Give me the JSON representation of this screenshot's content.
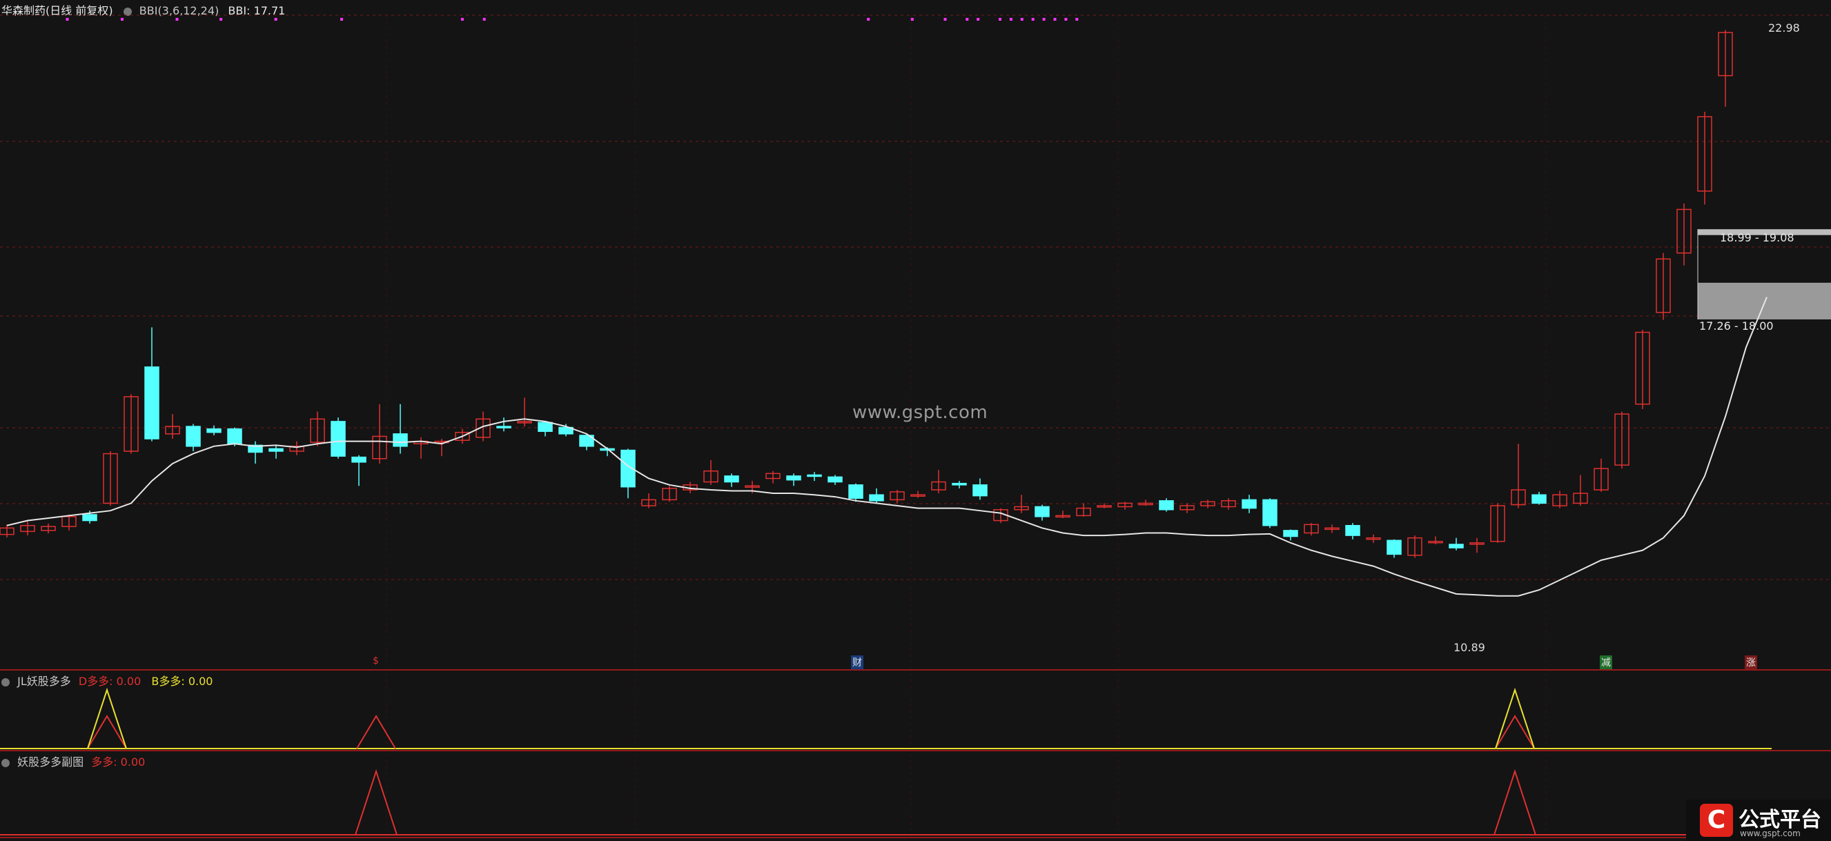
{
  "header": {
    "stock_name": "华森制药(日线 前复权)",
    "indicator_name": "BBI(3,6,12,24)",
    "indicator_value": "BBI: 17.71"
  },
  "sub1": {
    "name": "JL妖股多多",
    "d_label": "D多多: 0.00",
    "b_label": "B多多: 0.00"
  },
  "sub2": {
    "name": "妖股多多副图",
    "label": "多多: 0.00"
  },
  "markers": {
    "s": "$",
    "cai": "财",
    "jian": "减",
    "zhang": "涨"
  },
  "watermark": "www.gspt.com",
  "logo": {
    "text": "公式平台",
    "url": "www.gspt.com"
  },
  "colors": {
    "up": "#e03030",
    "down": "#54ffff",
    "bbi": "#e6e6e6",
    "d_line": "#e03030",
    "b_line": "#e8e030",
    "grid": "#7a1818",
    "dots": "#ff33ff"
  },
  "chart_data": {
    "type": "candlestick",
    "y_range": [
      10.2,
      23.4
    ],
    "annotations": {
      "high": "22.98",
      "low": "10.89",
      "zone_upper": "18.99 - 19.08",
      "zone_lower": "17.26 - 18.00"
    },
    "bbi": [
      13.1,
      13.2,
      13.25,
      13.3,
      13.35,
      13.4,
      13.55,
      14.0,
      14.35,
      14.55,
      14.7,
      14.75,
      14.7,
      14.72,
      14.68,
      14.75,
      14.8,
      14.8,
      14.8,
      14.78,
      14.8,
      14.75,
      14.9,
      15.1,
      15.2,
      15.25,
      15.2,
      15.1,
      14.95,
      14.65,
      14.3,
      14.05,
      13.92,
      13.85,
      13.82,
      13.8,
      13.8,
      13.75,
      13.75,
      13.72,
      13.68,
      13.6,
      13.55,
      13.5,
      13.45,
      13.45,
      13.45,
      13.4,
      13.35,
      13.2,
      13.05,
      12.95,
      12.9,
      12.9,
      12.92,
      12.95,
      12.95,
      12.92,
      12.9,
      12.9,
      12.92,
      12.93,
      12.75,
      12.6,
      12.48,
      12.38,
      12.28,
      12.12,
      11.98,
      11.85,
      11.72,
      11.7,
      11.68,
      11.68,
      11.8,
      12.0,
      12.2,
      12.4,
      12.5,
      12.6,
      12.85,
      13.3,
      14.1,
      15.3,
      16.7,
      17.71
    ],
    "candles": [
      [
        12.92,
        13.05,
        12.86,
        13.12
      ],
      [
        12.98,
        13.1,
        12.9,
        13.2
      ],
      [
        13.0,
        13.08,
        12.94,
        13.14
      ],
      [
        13.08,
        13.28,
        13.0,
        13.32
      ],
      [
        13.32,
        13.2,
        13.14,
        13.4
      ],
      [
        13.55,
        14.55,
        13.5,
        14.6
      ],
      [
        14.6,
        15.7,
        14.55,
        15.75
      ],
      [
        16.3,
        14.85,
        14.8,
        17.1
      ],
      [
        14.95,
        15.1,
        14.85,
        15.35
      ],
      [
        15.1,
        14.7,
        14.6,
        15.15
      ],
      [
        15.05,
        14.98,
        14.92,
        15.12
      ],
      [
        15.05,
        14.75,
        14.7,
        15.08
      ],
      [
        14.72,
        14.58,
        14.35,
        14.8
      ],
      [
        14.65,
        14.6,
        14.45,
        14.72
      ],
      [
        14.6,
        14.7,
        14.52,
        14.8
      ],
      [
        14.78,
        15.25,
        14.7,
        15.4
      ],
      [
        15.2,
        14.5,
        14.45,
        15.28
      ],
      [
        14.48,
        14.38,
        13.9,
        14.52
      ],
      [
        14.45,
        14.9,
        14.35,
        15.55
      ],
      [
        14.95,
        14.7,
        14.55,
        15.55
      ],
      [
        14.75,
        14.8,
        14.45,
        14.88
      ],
      [
        14.8,
        14.8,
        14.5,
        14.85
      ],
      [
        14.82,
        14.98,
        14.75,
        15.05
      ],
      [
        14.88,
        15.25,
        14.8,
        15.4
      ],
      [
        15.1,
        15.08,
        15.0,
        15.28
      ],
      [
        15.18,
        15.2,
        15.1,
        15.68
      ],
      [
        15.18,
        15.0,
        14.9,
        15.2
      ],
      [
        15.08,
        14.95,
        14.9,
        15.15
      ],
      [
        14.92,
        14.7,
        14.62,
        14.95
      ],
      [
        14.65,
        14.62,
        14.5,
        14.68
      ],
      [
        14.62,
        13.88,
        13.65,
        14.65
      ],
      [
        13.5,
        13.62,
        13.45,
        13.75
      ],
      [
        13.62,
        13.85,
        13.58,
        13.9
      ],
      [
        13.82,
        13.92,
        13.75,
        13.98
      ],
      [
        13.98,
        14.2,
        13.92,
        14.42
      ],
      [
        14.1,
        13.98,
        13.88,
        14.15
      ],
      [
        13.9,
        13.9,
        13.75,
        14.0
      ],
      [
        14.05,
        14.15,
        13.95,
        14.2
      ],
      [
        14.1,
        14.02,
        13.9,
        14.15
      ],
      [
        14.12,
        14.1,
        14.0,
        14.18
      ],
      [
        14.08,
        13.98,
        13.92,
        14.12
      ],
      [
        13.92,
        13.65,
        13.58,
        13.95
      ],
      [
        13.72,
        13.6,
        13.55,
        13.85
      ],
      [
        13.62,
        13.78,
        13.55,
        13.82
      ],
      [
        13.72,
        13.72,
        13.66,
        13.8
      ],
      [
        13.82,
        13.98,
        13.75,
        14.22
      ],
      [
        13.95,
        13.92,
        13.85,
        14.0
      ],
      [
        13.92,
        13.7,
        13.62,
        14.05
      ],
      [
        13.2,
        13.42,
        13.15,
        13.45
      ],
      [
        13.42,
        13.48,
        13.35,
        13.72
      ],
      [
        13.48,
        13.28,
        13.2,
        13.52
      ],
      [
        13.28,
        13.3,
        13.25,
        13.4
      ],
      [
        13.3,
        13.45,
        13.28,
        13.55
      ],
      [
        13.5,
        13.5,
        13.45,
        13.55
      ],
      [
        13.48,
        13.55,
        13.42,
        13.58
      ],
      [
        13.52,
        13.55,
        13.5,
        13.62
      ],
      [
        13.6,
        13.42,
        13.38,
        13.65
      ],
      [
        13.42,
        13.5,
        13.35,
        13.55
      ],
      [
        13.5,
        13.58,
        13.45,
        13.62
      ],
      [
        13.48,
        13.6,
        13.42,
        13.65
      ],
      [
        13.62,
        13.45,
        13.35,
        13.72
      ],
      [
        13.62,
        13.1,
        13.05,
        13.65
      ],
      [
        13.0,
        12.88,
        12.8,
        13.02
      ],
      [
        12.95,
        13.12,
        12.9,
        13.15
      ],
      [
        13.05,
        13.05,
        12.95,
        13.12
      ],
      [
        13.1,
        12.9,
        12.82,
        13.15
      ],
      [
        12.85,
        12.85,
        12.75,
        12.92
      ],
      [
        12.8,
        12.52,
        12.45,
        12.82
      ],
      [
        12.5,
        12.85,
        12.45,
        12.9
      ],
      [
        12.78,
        12.78,
        12.72,
        12.88
      ],
      [
        12.72,
        12.65,
        12.6,
        12.85
      ],
      [
        12.75,
        12.75,
        12.55,
        12.85
      ],
      [
        12.78,
        13.5,
        12.75,
        13.55
      ],
      [
        13.52,
        13.82,
        13.45,
        14.75
      ],
      [
        13.72,
        13.55,
        13.52,
        13.78
      ],
      [
        13.5,
        13.72,
        13.45,
        13.8
      ],
      [
        13.55,
        13.75,
        13.5,
        14.12
      ],
      [
        13.82,
        14.25,
        13.78,
        14.45
      ],
      [
        14.32,
        15.35,
        14.25,
        15.4
      ],
      [
        15.55,
        17.0,
        15.45,
        17.05
      ],
      [
        17.4,
        18.48,
        17.25,
        18.6
      ],
      [
        18.6,
        19.48,
        18.35,
        19.6
      ],
      [
        19.85,
        21.35,
        19.58,
        21.45
      ],
      [
        22.18,
        23.05,
        21.55,
        23.1
      ]
    ],
    "d_peaks": [
      5,
      18,
      73
    ],
    "b_peaks": [
      5,
      73
    ],
    "sub2_peaks": [
      18,
      73
    ]
  }
}
